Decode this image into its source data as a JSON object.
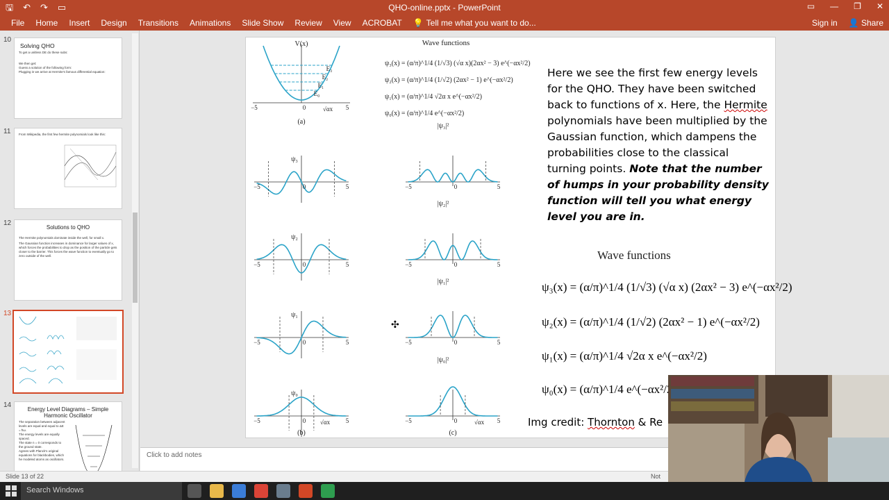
{
  "window": {
    "title": "QHO-online.pptx - PowerPoint"
  },
  "qat": {
    "save": "🖫",
    "undo": "↶",
    "redo": "↷",
    "present": "▭"
  },
  "window_buttons": {
    "ribbon_display": "▭",
    "minimize": "—",
    "restore": "❐",
    "close": "✕"
  },
  "ribbon": {
    "tabs": [
      "File",
      "Home",
      "Insert",
      "Design",
      "Transitions",
      "Animations",
      "Slide Show",
      "Review",
      "View",
      "ACROBAT"
    ],
    "tell_me": "Tell me what you want to do...",
    "sign_in": "Sign in",
    "share": "Share"
  },
  "thumbnails": [
    {
      "num": "10",
      "title": "Solving QHO",
      "body": [
        "To get a unitless DE do these subs:",
        "We then get:",
        "Guess a solution of the following form:",
        "Plugging in we arrive at Hermite's famous differential equation:"
      ]
    },
    {
      "num": "11",
      "title": "",
      "body": [
        "From Wikipedia, the first few hermite polynomials look like this:"
      ]
    },
    {
      "num": "12",
      "title": "Solutions to QHO",
      "body": [
        "The Hermite polynomials dominate inside the well, for small x.",
        "The Gaussian function increases in dominance for larger values of x, which forces the probabilities to drop as the position of the particle gets closer to the barrier. This forces the wave function to eventually go to zero outside of the well."
      ]
    },
    {
      "num": "13",
      "title": "",
      "body": []
    },
    {
      "num": "14",
      "title": "Energy Level Diagrams – Simple Harmonic Oscillator",
      "body": [
        "The separation between adjacent levels are equal and equal to ΔE = ħω.",
        "The energy levels are equally spaced.",
        "The state n = 0 corresponds to the ground state.",
        "Agrees with Planck's original equations for blackbodies, which he modeled atoms as oscillators."
      ]
    }
  ],
  "figure": {
    "top_title": "Wave functions",
    "labels": {
      "a": "(a)",
      "b": "(b)",
      "c": "(c)",
      "V": "V(x)",
      "psi3": "ψ₃",
      "psi2": "ψ₂",
      "psi1": "ψ₁",
      "psi0": "ψ₀",
      "abs3": "|ψ₃|²",
      "abs2": "|ψ₂|²",
      "abs1": "|ψ₁|²",
      "abs0": "|ψ₀|²",
      "xaxis": "√αx",
      "tick_neg": "−5",
      "tick_zero": "0",
      "tick_pos": "5",
      "E0": "E₀",
      "E1": "E₁",
      "E2": "E₂",
      "E3": "E₃"
    },
    "small_eqs": [
      "ψ₃(x) = (α/π)^1/4 (1/√3) (√α x)(2αx² − 3) e^(−αx²/2)",
      "ψ₂(x) = (α/π)^1/4 (1/√2) (2αx² − 1) e^(−αx²/2)",
      "ψ₁(x) = (α/π)^1/4 √2α x e^(−αx²/2)",
      "ψ₀(x) = (α/π)^1/4 e^(−αx²/2)"
    ]
  },
  "explanation": {
    "p1": "Here we see the first few energy levels for the QHO. They have been switched back to functions of x. Here, the",
    "hermite": "Hermite",
    "p2": "polynomials have been multiplied by the Gaussian function, which dampens the probabilities close to the classical turning points.",
    "bold": "Note that the number of humps in your probability density function will tell you what energy level you are in."
  },
  "wave_functions": {
    "title": "Wave functions",
    "eqs": [
      {
        "lhs": "ψ₃(x) = ",
        "rhs": "(α/π)^1/4 (1/√3) (√α x) (2αx² − 3) e^(−αx²/2)"
      },
      {
        "lhs": "ψ₂(x) = ",
        "rhs": "(α/π)^1/4 (1/√2) (2αx² − 1) e^(−αx²/2)"
      },
      {
        "lhs": "ψ₁(x) = ",
        "rhs": "(α/π)^1/4 √2α x e^(−αx²/2)"
      },
      {
        "lhs": "ψ₀(x) = ",
        "rhs": "(α/π)^1/4 e^(−αx²/2)"
      }
    ]
  },
  "credit": {
    "prefix": "Img credit: ",
    "name": "Thornton",
    "suffix": " & Re"
  },
  "notes": {
    "placeholder": "Click to add notes"
  },
  "status": {
    "slide": "Slide 13 of 22",
    "notes": "Not"
  },
  "taskbar": {
    "search": "Search Windows"
  }
}
